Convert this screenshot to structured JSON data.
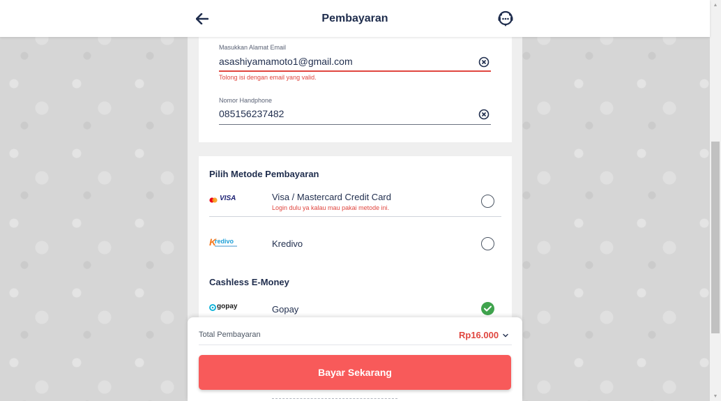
{
  "header": {
    "title": "Pembayaran",
    "back_icon": "arrow-left-icon",
    "support_icon": "chat-support-icon"
  },
  "contact": {
    "email": {
      "label": "Masukkan Alamat Email",
      "value": "asashiyamamoto1@gmail.com",
      "error": "Tolong isi dengan email yang valid.",
      "clear_icon": "clear-circle-icon"
    },
    "phone": {
      "label": "Nomor Handphone",
      "value": "085156237482",
      "clear_icon": "clear-circle-icon"
    }
  },
  "payment": {
    "section_title": "Pilih Metode Pembayaran",
    "methods": [
      {
        "logo_text": "VISA",
        "name": "Visa / Mastercard Credit Card",
        "note": "Login dulu ya kalau mau pakai metode ini.",
        "selected": false
      },
      {
        "logo_text": "redivo",
        "logo_initial": "K",
        "name": "Kredivo",
        "selected": false
      }
    ],
    "emoney_title": "Cashless E-Money",
    "emoney_methods": [
      {
        "logo_text": "gopay",
        "name": "Gopay",
        "selected": true
      }
    ]
  },
  "summary": {
    "total_label": "Total Pembayaran",
    "total_amount": "Rp16.000",
    "toggle_icon": "chevron-down-icon",
    "pay_button": "Bayar Sekarang"
  },
  "colors": {
    "accent": "#f85a5a",
    "error": "#e0463f",
    "primary_text": "#1f2d4d",
    "success": "#3fa34d"
  }
}
